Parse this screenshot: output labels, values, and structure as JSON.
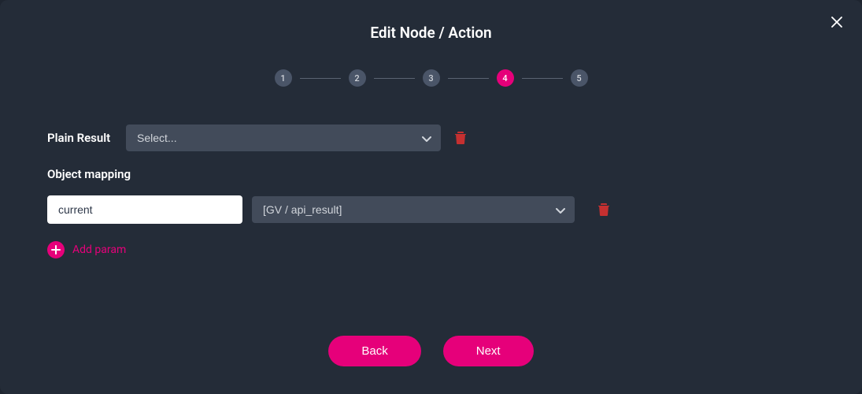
{
  "title": "Edit Node / Action",
  "stepper": {
    "steps": [
      "1",
      "2",
      "3",
      "4",
      "5"
    ],
    "active": 4
  },
  "plainResult": {
    "label": "Plain Result",
    "placeholder": "Select..."
  },
  "objectMapping": {
    "label": "Object mapping",
    "key": "current",
    "value": "[GV / api_result]"
  },
  "addParam": {
    "label": "Add param"
  },
  "buttons": {
    "back": "Back",
    "next": "Next"
  }
}
